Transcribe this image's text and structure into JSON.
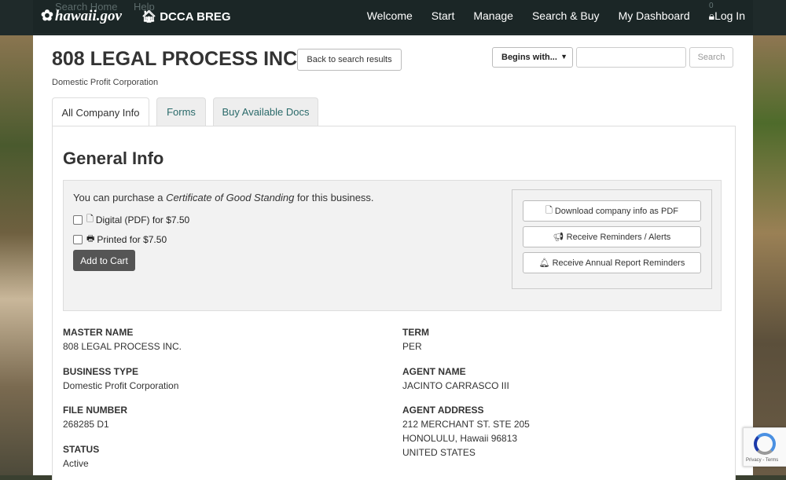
{
  "ghost_nav": {
    "search_home": "Search Home",
    "help": "Help",
    "cart": "0"
  },
  "header": {
    "brand": "hawaii.gov",
    "section": "DCCA BREG",
    "nav": [
      "Welcome",
      "Start",
      "Manage",
      "Search & Buy",
      "My Dashboard",
      "Log In"
    ]
  },
  "company": {
    "name": "808 LEGAL PROCESS INC.",
    "type_subtitle": "Domestic Profit Corporation",
    "back_button": "Back to search results"
  },
  "search": {
    "mode": "Begins with...",
    "placeholder": "",
    "button": "Search"
  },
  "tabs": [
    "All Company Info",
    "Forms",
    "Buy Available Docs"
  ],
  "general": {
    "heading": "General Info",
    "purchase_prefix": "You can purchase a ",
    "purchase_doc": "Certificate of Good Standing",
    "purchase_suffix": " for this business.",
    "option_digital": "Digital (PDF) for $7.50",
    "option_printed": "Printed for $7.50",
    "add_to_cart": "Add to Cart",
    "actions": [
      "Download company info as PDF",
      "Receive Reminders / Alerts",
      "Receive Annual Report Reminders"
    ]
  },
  "fields": {
    "master_name_label": "MASTER NAME",
    "master_name": "808 LEGAL PROCESS INC.",
    "business_type_label": "BUSINESS TYPE",
    "business_type": "Domestic Profit Corporation",
    "file_number_label": "FILE NUMBER",
    "file_number": "268285 D1",
    "status_label": "STATUS",
    "status": "Active",
    "term_label": "TERM",
    "term": "PER",
    "agent_name_label": "AGENT NAME",
    "agent_name": "JACINTO CARRASCO III",
    "agent_address_label": "AGENT ADDRESS",
    "agent_address": [
      "212 MERCHANT ST. STE 205",
      "HONOLULU, Hawaii 96813",
      "UNITED STATES"
    ]
  },
  "recaptcha": {
    "terms": "Privacy - Terms"
  }
}
